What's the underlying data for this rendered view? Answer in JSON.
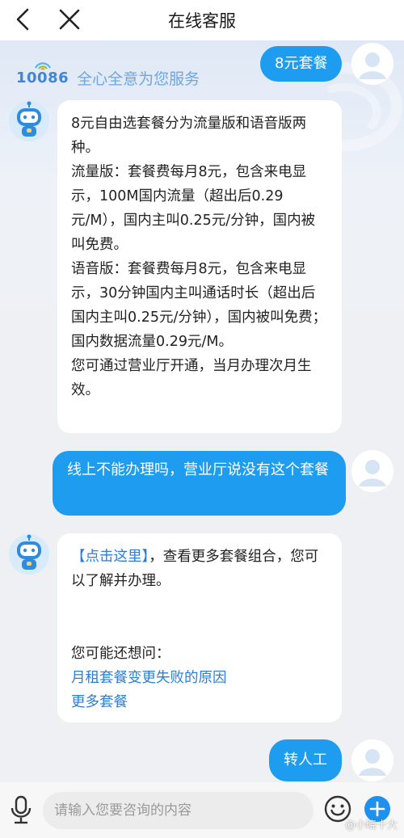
{
  "header": {
    "title": "在线客服",
    "back_icon": "chevron-left-icon",
    "close_icon": "close-icon"
  },
  "brand": {
    "number": "10086",
    "slogan": "全心全意为您服务",
    "color": "#3f86d8"
  },
  "messages": [
    {
      "from": "user",
      "text": "8元套餐"
    },
    {
      "from": "bot",
      "paragraphs": [
        "8元自由选套餐分为流量版和语音版两种。",
        "流量版：套餐费每月8元，包含来电显示，100M国内流量（超出后0.29元/M），国内主叫0.25元/分钟，国内被叫免费。",
        "语音版：套餐费每月8元，包含来电显示，30分钟国内主叫通话时长（超出后国内主叫0.25元/分钟），国内被叫免费；国内数据流量0.29元/M。",
        "您可通过营业厅开通，当月办理次月生效。"
      ]
    },
    {
      "from": "user",
      "text": "线上不能办理吗，营业厅说没有这个套餐"
    },
    {
      "from": "bot",
      "link": "【点击这里】",
      "text": "，查看更多套餐组合，您可以了解并办理。",
      "suggest_title": "您可能还想问：",
      "suggestions": [
        "月租套餐变更失败的原因",
        "更多套餐"
      ]
    },
    {
      "from": "user",
      "text": "转人工"
    }
  ],
  "input": {
    "placeholder": "请输入您要咨询的内容",
    "mic_icon": "microphone-icon",
    "emoji_icon": "emoji-icon",
    "plus_icon": "plus-icon"
  },
  "watermark": "@小晓十大",
  "colors": {
    "user_bubble": "#1e9df0",
    "bot_bubble": "#ffffff",
    "link": "#2a7ed8",
    "accent": "#1e90ee"
  }
}
